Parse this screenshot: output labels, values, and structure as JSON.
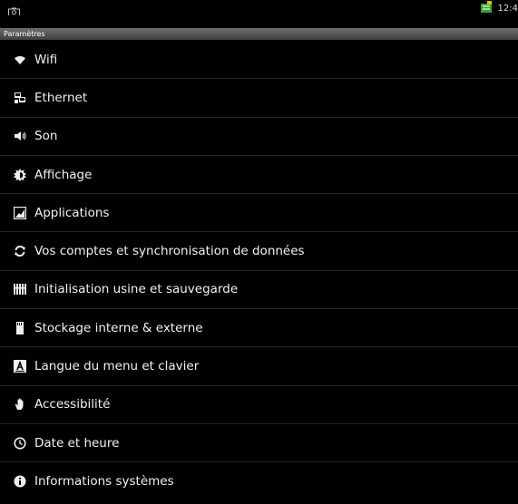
{
  "status_bar": {
    "time": "12:4",
    "icons": [
      "camera-icon",
      "download-notification-icon"
    ]
  },
  "title_bar": {
    "title": "Paramètres"
  },
  "settings": {
    "items": [
      {
        "label": "Wifi",
        "icon": "wifi-icon"
      },
      {
        "label": "Ethernet",
        "icon": "ethernet-icon"
      },
      {
        "label": "Son",
        "icon": "speaker-icon"
      },
      {
        "label": "Affichage",
        "icon": "brightness-icon"
      },
      {
        "label": "Applications",
        "icon": "applications-icon"
      },
      {
        "label": "Vos comptes et synchronisation de données",
        "icon": "sync-icon"
      },
      {
        "label": "Initialisation usine et sauvegarde",
        "icon": "factory-reset-icon"
      },
      {
        "label": "Stockage interne & externe",
        "icon": "sd-card-icon"
      },
      {
        "label": "Langue du menu et clavier",
        "icon": "language-icon"
      },
      {
        "label": "Accessibilité",
        "icon": "hand-icon"
      },
      {
        "label": "Date et heure",
        "icon": "clock-icon"
      },
      {
        "label": "Informations systèmes",
        "icon": "info-icon"
      }
    ]
  }
}
